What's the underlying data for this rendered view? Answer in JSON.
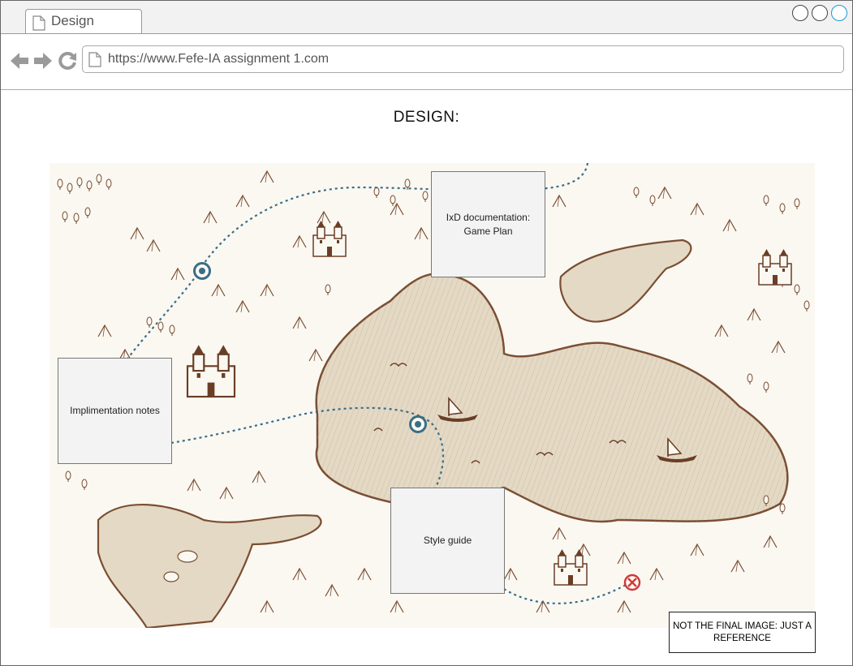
{
  "browser": {
    "tab_label": "Design",
    "url": "https://www.Fefe-IA assignment 1.com"
  },
  "page": {
    "title": "DESIGN:"
  },
  "map": {
    "image_subject": "vintage hand-drawn sea map with castles, ships and mountains",
    "boxes": {
      "ixd": "IxD documentation: Game Plan",
      "impl": "Implimentation notes",
      "style": "Style guide"
    },
    "note": "NOT THE FINAL IMAGE: JUST A REFERENCE"
  },
  "colors": {
    "path": "#3a6e86",
    "map_ink": "#7a4e33",
    "sea": "#e4d9c4",
    "land": "#fbf8f2",
    "end_marker": "#d23a3a"
  }
}
